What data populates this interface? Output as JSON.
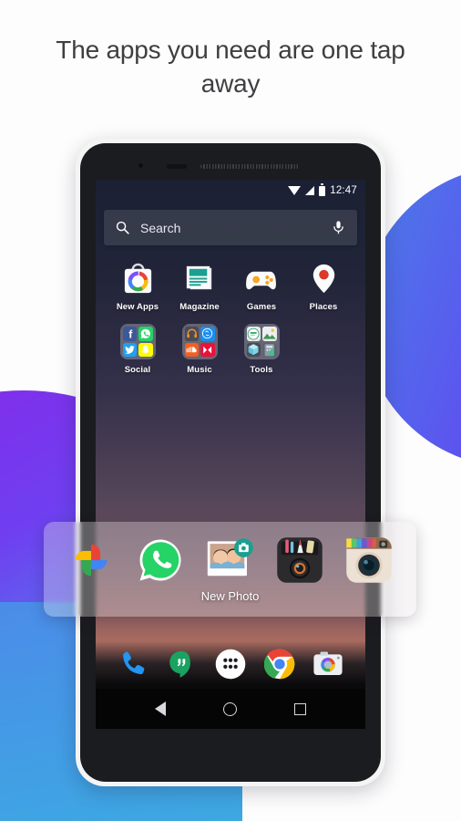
{
  "headline": "The apps you need are one tap away",
  "colors": {
    "blob_purple": "#6f3ff0",
    "blob_blue": "#3da8e2",
    "accent_teal": "#1aa090",
    "headline_text": "#3f3f42"
  },
  "phone": {
    "statusbar": {
      "wifi_icon": "wifi-icon",
      "signal_icon": "signal-icon",
      "battery_icon": "battery-icon",
      "time": "12:47"
    },
    "search": {
      "placeholder": "Search",
      "search_icon": "search-icon",
      "mic_icon": "microphone-icon"
    },
    "app_rows": [
      [
        {
          "label": "New Apps",
          "icon": "new-apps-icon",
          "type": "app"
        },
        {
          "label": "Magazine",
          "icon": "magazine-icon",
          "type": "app"
        },
        {
          "label": "Games",
          "icon": "games-gamepad-icon",
          "type": "app"
        },
        {
          "label": "Places",
          "icon": "places-pin-icon",
          "type": "app"
        }
      ],
      [
        {
          "label": "Social",
          "icon": "social-folder-icon",
          "type": "folder"
        },
        {
          "label": "Music",
          "icon": "music-folder-icon",
          "type": "folder"
        },
        {
          "label": "Tools",
          "icon": "tools-folder-icon",
          "type": "folder"
        }
      ]
    ],
    "dock": [
      {
        "label": "Phone",
        "icon": "phone-icon"
      },
      {
        "label": "Hangouts",
        "icon": "hangouts-icon"
      },
      {
        "label": "All Apps",
        "icon": "app-drawer-icon"
      },
      {
        "label": "Chrome",
        "icon": "chrome-icon"
      },
      {
        "label": "Camera",
        "icon": "camera-icon"
      }
    ],
    "navbar": [
      {
        "label": "Back",
        "icon": "back-triangle-icon"
      },
      {
        "label": "Home",
        "icon": "home-circle-icon"
      },
      {
        "label": "Recents",
        "icon": "recents-square-icon"
      }
    ]
  },
  "overlay": {
    "items": [
      {
        "label": "",
        "icon": "google-photos-icon"
      },
      {
        "label": "",
        "icon": "whatsapp-icon"
      },
      {
        "label": "New Photo",
        "icon": "new-photo-thumbnail-icon"
      },
      {
        "label": "",
        "icon": "camera-app-icon"
      },
      {
        "label": "",
        "icon": "instagram-icon"
      }
    ]
  }
}
